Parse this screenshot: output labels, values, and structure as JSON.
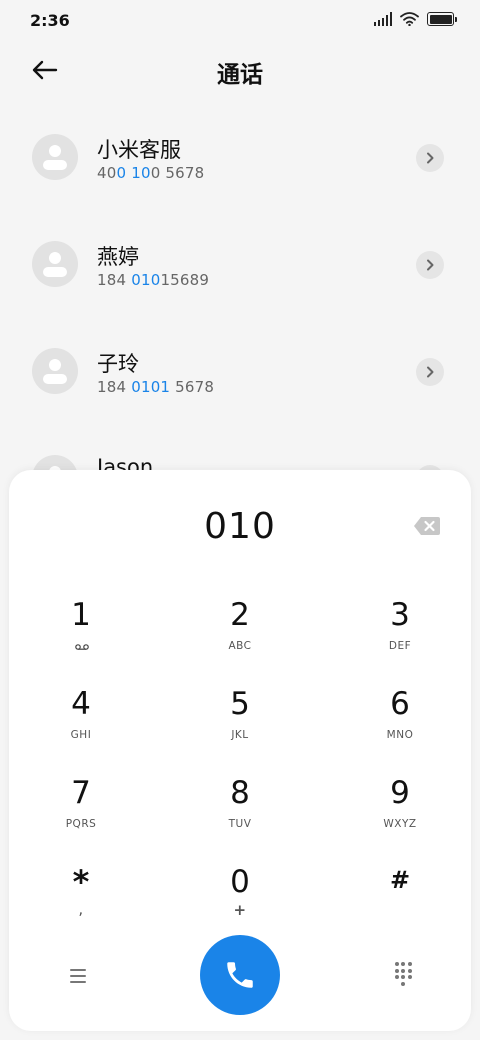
{
  "status_bar": {
    "time": "2:36"
  },
  "header": {
    "title": "通话"
  },
  "contacts": [
    {
      "name": "小米客服",
      "number_parts": [
        "40",
        "0 10",
        "0 5678"
      ]
    },
    {
      "name": "燕婷",
      "number_parts": [
        "184 ",
        "010",
        "15689"
      ]
    },
    {
      "name": "子玲",
      "number_parts": [
        "184 ",
        "0101",
        " 5678"
      ]
    },
    {
      "name": "Jason",
      "number_parts": [
        "",
        "",
        ""
      ]
    }
  ],
  "dialer": {
    "display": "010",
    "keys": [
      {
        "digit": "1",
        "letters": ""
      },
      {
        "digit": "2",
        "letters": "ABC"
      },
      {
        "digit": "3",
        "letters": "DEF"
      },
      {
        "digit": "4",
        "letters": "GHI"
      },
      {
        "digit": "5",
        "letters": "JKL"
      },
      {
        "digit": "6",
        "letters": "MNO"
      },
      {
        "digit": "7",
        "letters": "PQRS"
      },
      {
        "digit": "8",
        "letters": "TUV"
      },
      {
        "digit": "9",
        "letters": "WXYZ"
      },
      {
        "digit": "*",
        "letters": ","
      },
      {
        "digit": "0",
        "letters": "+"
      },
      {
        "digit": "#",
        "letters": ""
      }
    ]
  },
  "colors": {
    "accent": "#1a84e8",
    "background": "#f5f5f5",
    "panel": "#ffffff"
  },
  "icons": {
    "back": "arrow-left-icon",
    "chevron": "chevron-right-icon",
    "backspace": "backspace-icon",
    "voicemail": "voicemail-icon",
    "menu": "menu-icon",
    "call": "phone-icon",
    "keypad": "dialpad-icon"
  }
}
